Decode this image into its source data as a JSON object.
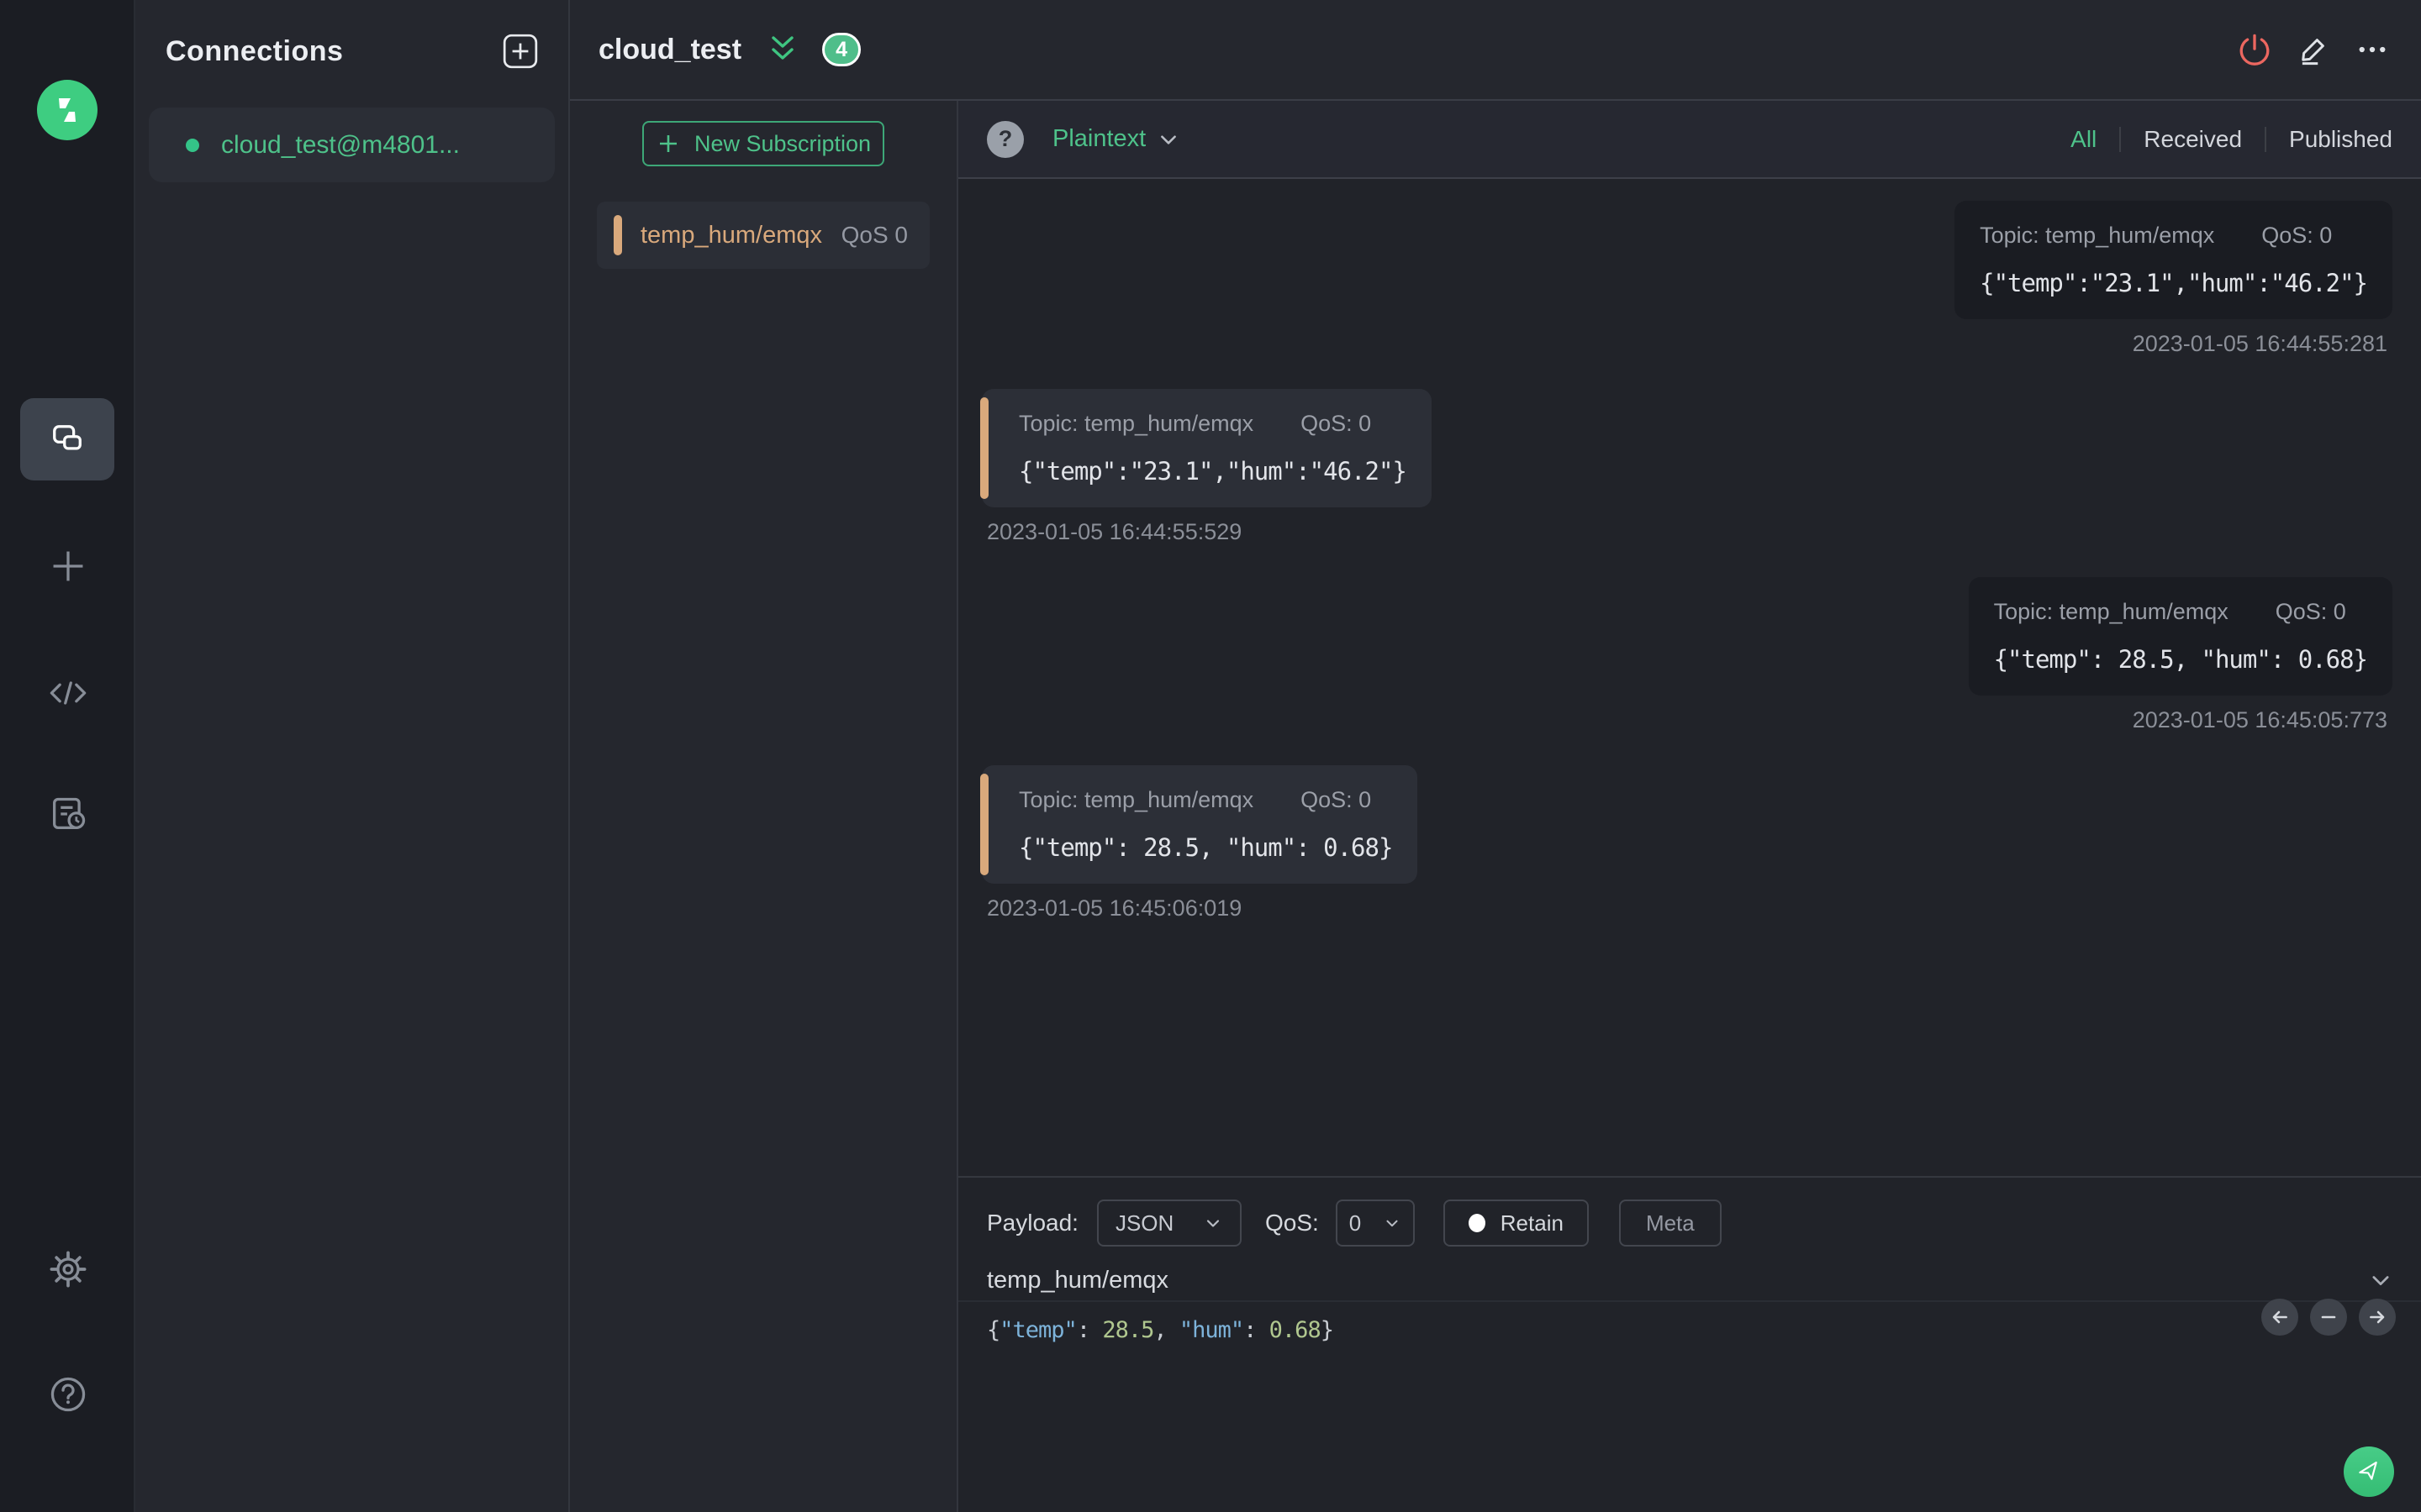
{
  "colors": {
    "accent_green": "#3ec57e",
    "danger_red": "#ec6760",
    "topic_tan": "#d9a97c",
    "panel_bg": "#25272e",
    "messages_bg": "#212329"
  },
  "rail_icons": [
    "mqttx-logo",
    "connections",
    "new-connection",
    "script",
    "log",
    "settings",
    "help"
  ],
  "connections_panel": {
    "title": "Connections",
    "connection": {
      "name": "cloud_test@m4801...",
      "status": "connected"
    }
  },
  "header": {
    "title": "cloud_test",
    "badge_count": "4",
    "action_icons": [
      "disconnect-power",
      "edit-pencil",
      "more-ellipsis"
    ]
  },
  "subscriptions": {
    "new_button_label": "New Subscription",
    "item": {
      "topic": "temp_hum/emqx",
      "qos": "QoS 0"
    }
  },
  "messages_toolbar": {
    "help_glyph": "?",
    "format": "Plaintext",
    "filters": {
      "all": "All",
      "received": "Received",
      "published": "Published"
    },
    "active_filter": "All"
  },
  "messages": {
    "items": [
      {
        "direction": "published",
        "topic": "Topic: temp_hum/emqx",
        "qos": "QoS: 0",
        "payload": "{\"temp\":\"23.1\",\"hum\":\"46.2\"}",
        "timestamp": "2023-01-05 16:44:55:281"
      },
      {
        "direction": "received",
        "topic": "Topic: temp_hum/emqx",
        "qos": "QoS: 0",
        "payload": "{\"temp\":\"23.1\",\"hum\":\"46.2\"}",
        "timestamp": "2023-01-05 16:44:55:529"
      },
      {
        "direction": "published",
        "topic": "Topic: temp_hum/emqx",
        "qos": "QoS: 0",
        "payload": "{\"temp\": 28.5, \"hum\": 0.68}",
        "timestamp": "2023-01-05 16:45:05:773"
      },
      {
        "direction": "received",
        "topic": "Topic: temp_hum/emqx",
        "qos": "QoS: 0",
        "payload": "{\"temp\": 28.5, \"hum\": 0.68}",
        "timestamp": "2023-01-05 16:45:06:019"
      }
    ]
  },
  "publish": {
    "payload_label": "Payload:",
    "format_value": "JSON",
    "qos_label": "QoS:",
    "qos_value": "0",
    "retain_label": "Retain",
    "meta_label": "Meta",
    "topic_value": "temp_hum/emqx",
    "payload_tokens": {
      "open": "{",
      "key1": "\"temp\"",
      "sep1": ": ",
      "val1": "28.5",
      "comma": ", ",
      "key2": "\"hum\"",
      "sep2": ": ",
      "val2": "0.68",
      "close": "}"
    }
  }
}
